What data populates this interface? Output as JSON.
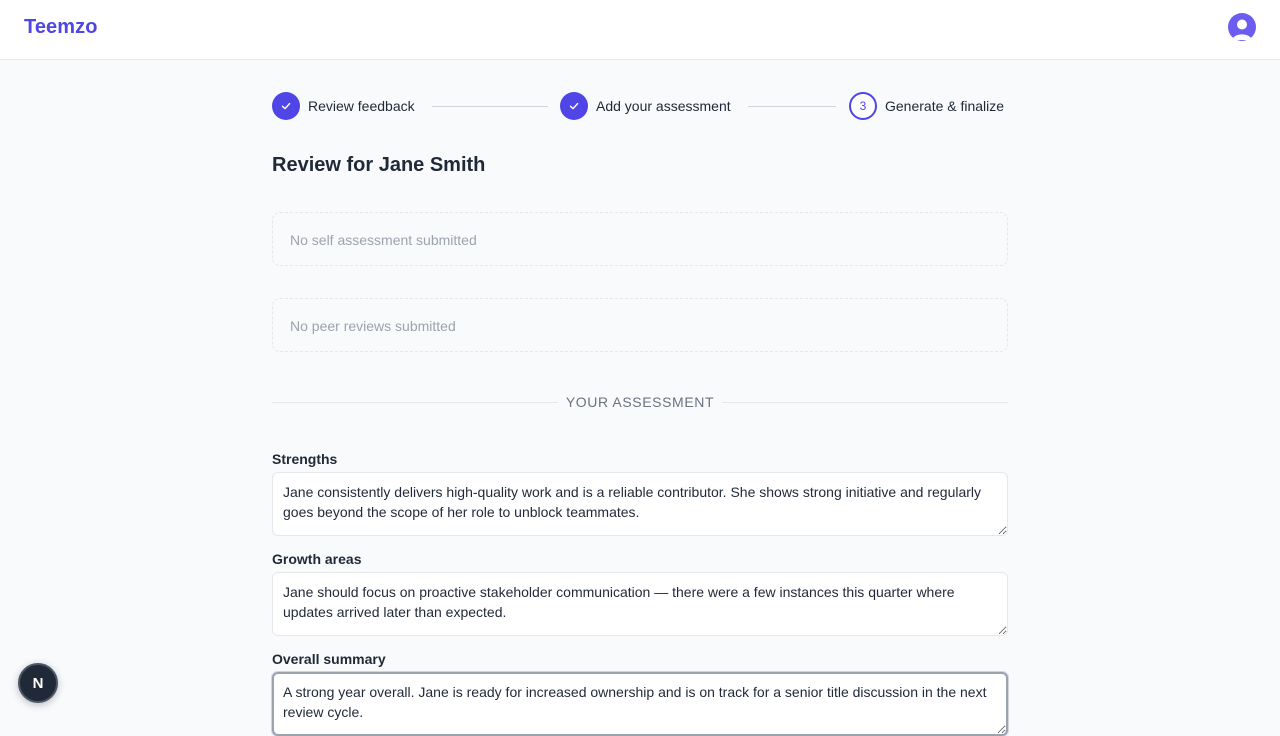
{
  "app": {
    "brand": "Teemzo",
    "avatar_icon": "user-avatar-icon"
  },
  "stepper": {
    "steps": [
      {
        "label": "Review feedback",
        "state": "complete",
        "icon": "check-icon"
      },
      {
        "label": "Add your assessment",
        "state": "complete",
        "icon": "check-icon"
      },
      {
        "label": "Generate & finalize",
        "state": "current",
        "number": "3"
      }
    ]
  },
  "page": {
    "title": "Review for Jane Smith"
  },
  "self_assessment": {
    "empty_text": "No self assessment submitted"
  },
  "peer_reviews": {
    "empty_text": "No peer reviews submitted"
  },
  "assessment": {
    "section_label": "YOUR ASSESSMENT",
    "strengths": {
      "label": "Strengths",
      "value": "Jane consistently delivers high-quality work and is a reliable contributor. She shows strong initiative and regularly goes beyond the scope of her role to unblock teammates."
    },
    "growth_areas": {
      "label": "Growth areas",
      "value": "Jane should focus on proactive stakeholder communication — there were a few instances this quarter where updates arrived later than expected."
    },
    "overall_summary": {
      "label": "Overall summary",
      "value": "A strong year overall. Jane is ready for increased ownership and is on track for a senior title discussion in the next review cycle."
    }
  },
  "dev_badge": {
    "letter": "N"
  },
  "colors": {
    "accent": "#4f46e5",
    "background": "#f8fafc",
    "text": "#1f2937",
    "muted": "#9ca3af"
  }
}
